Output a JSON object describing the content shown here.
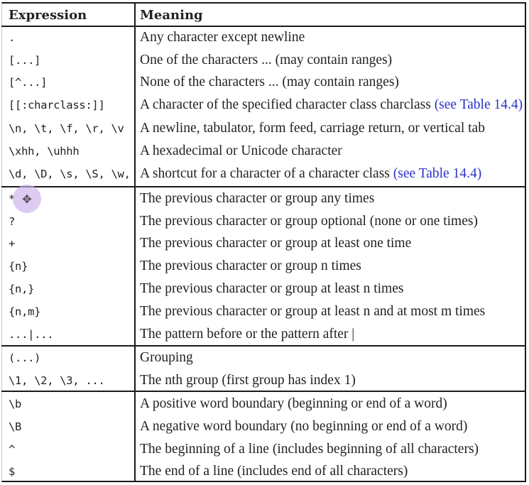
{
  "header": {
    "expression": "Expression",
    "meaning": "Meaning"
  },
  "rows": [
    {
      "expr": ".",
      "meaning": "Any character except newline"
    },
    {
      "expr": "[...]",
      "meaning": "One of the characters ... (may contain ranges)"
    },
    {
      "expr": "[^...]",
      "meaning": "None of the characters ... (may contain ranges)"
    },
    {
      "expr": "[[:charclass:]]",
      "meaning": "A character of the specified character class charclass",
      "link": " (see Table 14.4)"
    },
    {
      "expr": "\\n, \\t, \\f, \\r, \\v",
      "meaning": "A newline, tabulator, form feed, carriage return, or vertical tab"
    },
    {
      "expr": "\\xhh, \\uhhh",
      "meaning": "A hexadecimal or Unicode character"
    },
    {
      "expr": "\\d, \\D, \\s, \\S, \\w, \\W",
      "meaning": "A shortcut for a character of a character class",
      "link": " (see Table 14.4)"
    },
    {
      "expr": "*",
      "meaning": "The previous character or group any times"
    },
    {
      "expr": "?",
      "meaning": "The previous character or group optional (none or one times)"
    },
    {
      "expr": "+",
      "meaning": "The previous character or group at least one time"
    },
    {
      "expr": "{n}",
      "meaning": "The previous character or group n times"
    },
    {
      "expr": "{n,}",
      "meaning": "The previous character or group at least n times"
    },
    {
      "expr": "{n,m}",
      "meaning": "The previous character or group at least n and at most m times"
    },
    {
      "expr": "...|...",
      "meaning": "The pattern before or the pattern after |"
    },
    {
      "expr": "(...)",
      "meaning": "Grouping"
    },
    {
      "expr": "\\1, \\2, \\3, ...",
      "meaning": "The nth group (first group has index 1)"
    },
    {
      "expr": "\\b",
      "meaning": "A positive word boundary (beginning or end of a word)"
    },
    {
      "expr": "\\B",
      "meaning": "A negative word boundary (no beginning or end of a word)"
    },
    {
      "expr": "^",
      "meaning": "The beginning of a line (includes beginning of all characters)"
    },
    {
      "expr": "$",
      "meaning": "The end of a line (includes end of all characters)"
    }
  ],
  "cursor_icon": "move-cursor-icon"
}
